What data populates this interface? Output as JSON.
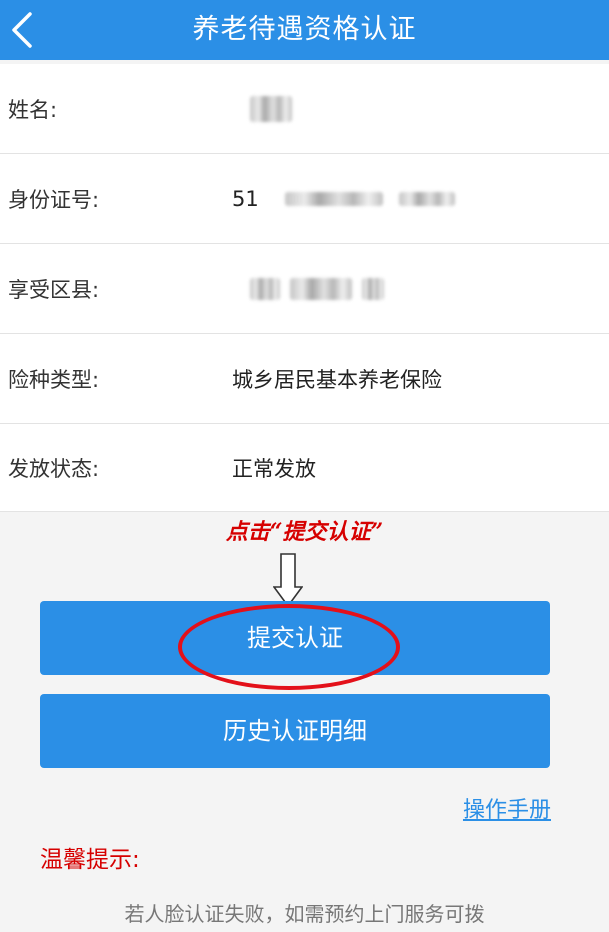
{
  "header": {
    "title": "养老待遇资格认证"
  },
  "info": {
    "name_label": "姓名:",
    "id_label": "身份证号:",
    "id_prefix": "51",
    "district_label": "享受区县:",
    "insurance_label": "险种类型:",
    "insurance_value": "城乡居民基本养老保险",
    "status_label": "发放状态:",
    "status_value": "正常发放"
  },
  "annotation": {
    "hint": "点击“提交认证”"
  },
  "buttons": {
    "submit_label": "提交认证",
    "history_label": "历史认证明细"
  },
  "links": {
    "manual_label": "操作手册"
  },
  "tips": {
    "title": "温馨提示:",
    "text": "若人脸认证失败，如需预约上门服务可拨"
  },
  "colors": {
    "primary": "#2b8fe6",
    "annotation_red": "#d60000"
  }
}
